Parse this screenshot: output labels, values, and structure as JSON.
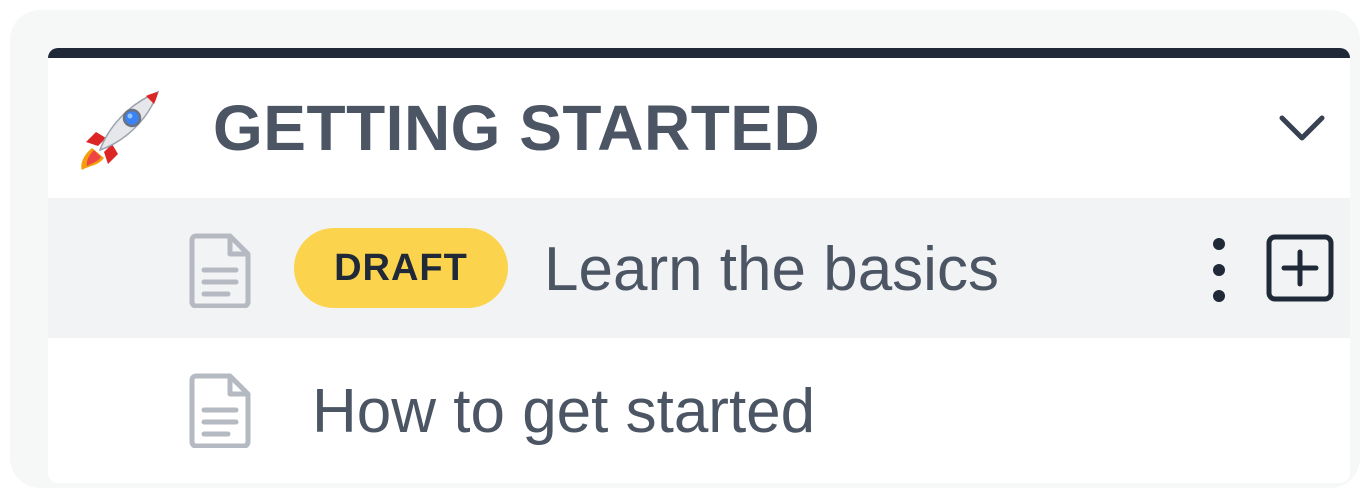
{
  "section": {
    "title": "GETTING STARTED",
    "icon": "rocket-icon",
    "toggle_icon": "chevron-down-icon",
    "accent_bar_color": "#1f2937"
  },
  "docs": [
    {
      "label": "Learn the basics",
      "badge": "DRAFT",
      "badge_color": "#fcd34d",
      "icon": "document-icon",
      "selected": true,
      "actions": [
        "more-icon",
        "add-icon"
      ]
    },
    {
      "label": "How to get started",
      "icon": "document-icon",
      "selected": false
    }
  ]
}
